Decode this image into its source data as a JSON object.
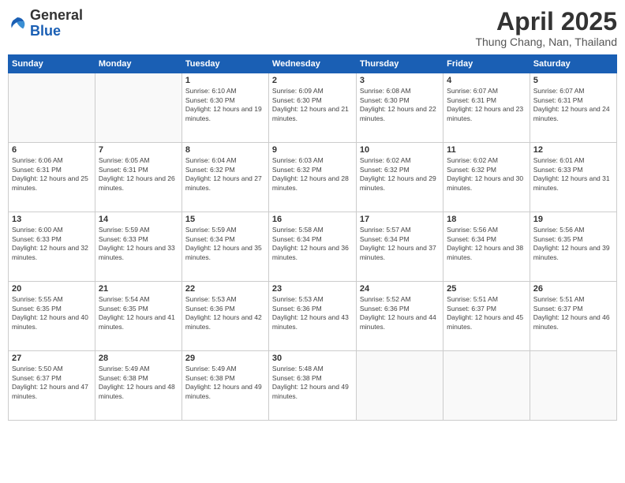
{
  "logo": {
    "general": "General",
    "blue": "Blue"
  },
  "header": {
    "month": "April 2025",
    "location": "Thung Chang, Nan, Thailand"
  },
  "days_of_week": [
    "Sunday",
    "Monday",
    "Tuesday",
    "Wednesday",
    "Thursday",
    "Friday",
    "Saturday"
  ],
  "weeks": [
    [
      {
        "day": "",
        "empty": true
      },
      {
        "day": "",
        "empty": true
      },
      {
        "day": "1",
        "sunrise": "6:10 AM",
        "sunset": "6:30 PM",
        "daylight": "12 hours and 19 minutes."
      },
      {
        "day": "2",
        "sunrise": "6:09 AM",
        "sunset": "6:30 PM",
        "daylight": "12 hours and 21 minutes."
      },
      {
        "day": "3",
        "sunrise": "6:08 AM",
        "sunset": "6:30 PM",
        "daylight": "12 hours and 22 minutes."
      },
      {
        "day": "4",
        "sunrise": "6:07 AM",
        "sunset": "6:31 PM",
        "daylight": "12 hours and 23 minutes."
      },
      {
        "day": "5",
        "sunrise": "6:07 AM",
        "sunset": "6:31 PM",
        "daylight": "12 hours and 24 minutes."
      }
    ],
    [
      {
        "day": "6",
        "sunrise": "6:06 AM",
        "sunset": "6:31 PM",
        "daylight": "12 hours and 25 minutes."
      },
      {
        "day": "7",
        "sunrise": "6:05 AM",
        "sunset": "6:31 PM",
        "daylight": "12 hours and 26 minutes."
      },
      {
        "day": "8",
        "sunrise": "6:04 AM",
        "sunset": "6:32 PM",
        "daylight": "12 hours and 27 minutes."
      },
      {
        "day": "9",
        "sunrise": "6:03 AM",
        "sunset": "6:32 PM",
        "daylight": "12 hours and 28 minutes."
      },
      {
        "day": "10",
        "sunrise": "6:02 AM",
        "sunset": "6:32 PM",
        "daylight": "12 hours and 29 minutes."
      },
      {
        "day": "11",
        "sunrise": "6:02 AM",
        "sunset": "6:32 PM",
        "daylight": "12 hours and 30 minutes."
      },
      {
        "day": "12",
        "sunrise": "6:01 AM",
        "sunset": "6:33 PM",
        "daylight": "12 hours and 31 minutes."
      }
    ],
    [
      {
        "day": "13",
        "sunrise": "6:00 AM",
        "sunset": "6:33 PM",
        "daylight": "12 hours and 32 minutes."
      },
      {
        "day": "14",
        "sunrise": "5:59 AM",
        "sunset": "6:33 PM",
        "daylight": "12 hours and 33 minutes."
      },
      {
        "day": "15",
        "sunrise": "5:59 AM",
        "sunset": "6:34 PM",
        "daylight": "12 hours and 35 minutes."
      },
      {
        "day": "16",
        "sunrise": "5:58 AM",
        "sunset": "6:34 PM",
        "daylight": "12 hours and 36 minutes."
      },
      {
        "day": "17",
        "sunrise": "5:57 AM",
        "sunset": "6:34 PM",
        "daylight": "12 hours and 37 minutes."
      },
      {
        "day": "18",
        "sunrise": "5:56 AM",
        "sunset": "6:34 PM",
        "daylight": "12 hours and 38 minutes."
      },
      {
        "day": "19",
        "sunrise": "5:56 AM",
        "sunset": "6:35 PM",
        "daylight": "12 hours and 39 minutes."
      }
    ],
    [
      {
        "day": "20",
        "sunrise": "5:55 AM",
        "sunset": "6:35 PM",
        "daylight": "12 hours and 40 minutes."
      },
      {
        "day": "21",
        "sunrise": "5:54 AM",
        "sunset": "6:35 PM",
        "daylight": "12 hours and 41 minutes."
      },
      {
        "day": "22",
        "sunrise": "5:53 AM",
        "sunset": "6:36 PM",
        "daylight": "12 hours and 42 minutes."
      },
      {
        "day": "23",
        "sunrise": "5:53 AM",
        "sunset": "6:36 PM",
        "daylight": "12 hours and 43 minutes."
      },
      {
        "day": "24",
        "sunrise": "5:52 AM",
        "sunset": "6:36 PM",
        "daylight": "12 hours and 44 minutes."
      },
      {
        "day": "25",
        "sunrise": "5:51 AM",
        "sunset": "6:37 PM",
        "daylight": "12 hours and 45 minutes."
      },
      {
        "day": "26",
        "sunrise": "5:51 AM",
        "sunset": "6:37 PM",
        "daylight": "12 hours and 46 minutes."
      }
    ],
    [
      {
        "day": "27",
        "sunrise": "5:50 AM",
        "sunset": "6:37 PM",
        "daylight": "12 hours and 47 minutes."
      },
      {
        "day": "28",
        "sunrise": "5:49 AM",
        "sunset": "6:38 PM",
        "daylight": "12 hours and 48 minutes."
      },
      {
        "day": "29",
        "sunrise": "5:49 AM",
        "sunset": "6:38 PM",
        "daylight": "12 hours and 49 minutes."
      },
      {
        "day": "30",
        "sunrise": "5:48 AM",
        "sunset": "6:38 PM",
        "daylight": "12 hours and 49 minutes."
      },
      {
        "day": "",
        "empty": true
      },
      {
        "day": "",
        "empty": true
      },
      {
        "day": "",
        "empty": true
      }
    ]
  ],
  "labels": {
    "sunrise_prefix": "Sunrise: ",
    "sunset_prefix": "Sunset: ",
    "daylight_prefix": "Daylight: "
  }
}
